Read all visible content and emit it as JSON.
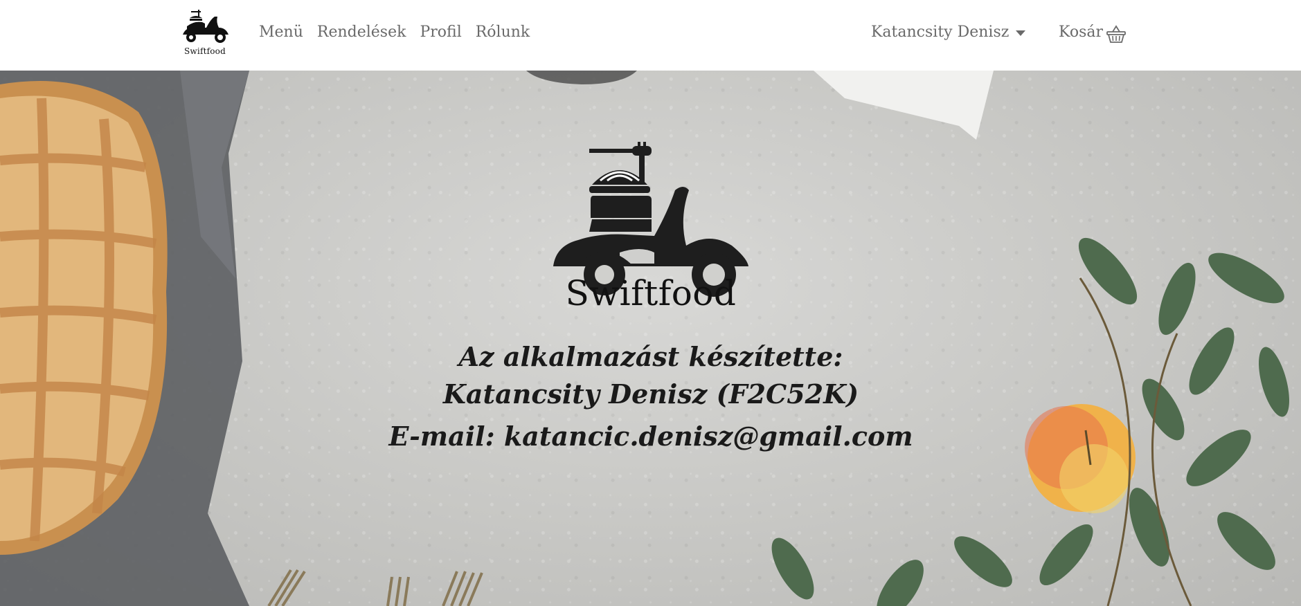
{
  "brand": {
    "name": "Swiftfood",
    "logo_icon": "scooter-delivery-icon"
  },
  "nav": {
    "links": [
      "Menü",
      "Rendelések",
      "Profil",
      "Rólunk"
    ],
    "user_name": "Katancsity Denisz",
    "cart_label": "Kosár",
    "cart_icon": "basket-icon"
  },
  "hero": {
    "logo_name": "Swiftfood",
    "credit_line1": "Az alkalmazást készítette:",
    "credit_line2": "Katancsity Denisz (F2C52K)",
    "credit_line3": "E-mail: katancic.denisz@gmail.com"
  },
  "colors": {
    "nav_text": "#6a6a6a",
    "nav_bg": "#ffffff",
    "text_dark": "#1a1a1a"
  }
}
